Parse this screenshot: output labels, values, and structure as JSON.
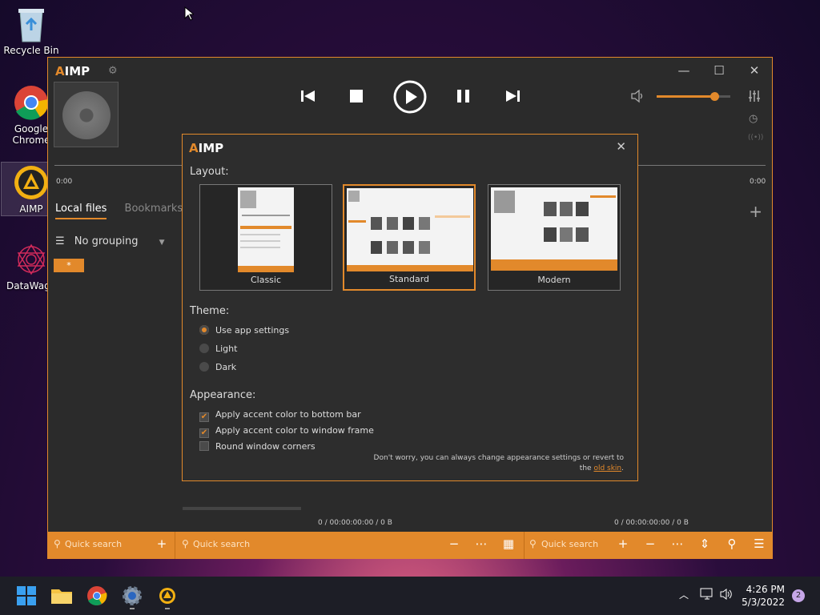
{
  "desktop": {
    "recycle_bin": "Recycle Bin",
    "chrome": "Google Chrome",
    "aimp": "AIMP",
    "datawagon": "DataWago"
  },
  "player": {
    "logo_a": "A",
    "logo_rest": "IMP",
    "time_start": "0:00",
    "time_end": "0:00",
    "volume_percent": 78,
    "tabs": [
      "Local files",
      "Bookmarks"
    ],
    "grouping": "No grouping",
    "playlist_tab": "*",
    "footer_left": "0 / 00:00:00:00 / 0 B",
    "footer_right": "0 / 00:00:00:00 / 0 B",
    "quick_search": "Quick search"
  },
  "dialog": {
    "layout_label": "Layout:",
    "layouts": [
      "Classic",
      "Standard",
      "Modern"
    ],
    "theme_label": "Theme:",
    "themes": [
      "Use app settings",
      "Light",
      "Dark"
    ],
    "appearance_label": "Appearance:",
    "options": [
      "Apply accent color to bottom bar",
      "Apply accent color to window frame",
      "Round window corners"
    ],
    "note_line1": "Don't worry, you can always change appearance settings or revert to",
    "note_prefix": "the ",
    "note_link": "old skin",
    "note_suffix": "."
  },
  "taskbar": {
    "time": "4:26 PM",
    "date": "5/3/2022",
    "notifications": "2"
  },
  "colors": {
    "accent": "#e2892b",
    "window_bg": "#2b2b2b",
    "taskbar_bg": "#1d1e26"
  }
}
